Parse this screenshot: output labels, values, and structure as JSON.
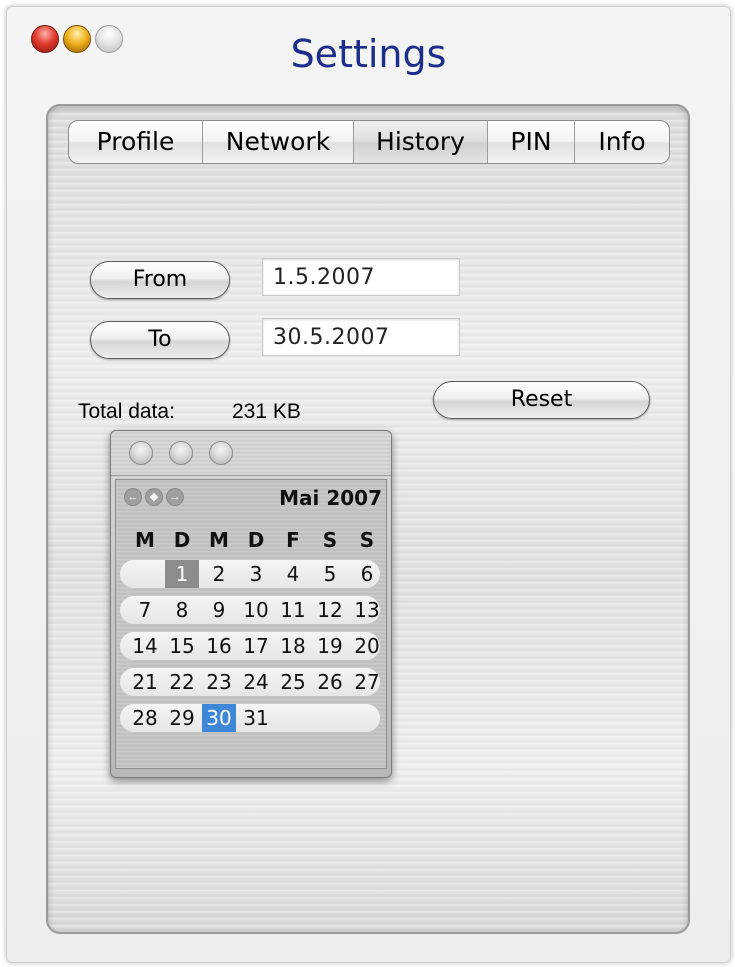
{
  "window": {
    "title": "Settings"
  },
  "tabs": [
    {
      "label": "Profile",
      "selected": false
    },
    {
      "label": "Network",
      "selected": false
    },
    {
      "label": "History",
      "selected": true
    },
    {
      "label": "PIN",
      "selected": false
    },
    {
      "label": "Info",
      "selected": false
    }
  ],
  "history": {
    "from_label": "From",
    "from_value": "1.5.2007",
    "to_label": "To",
    "to_value": "30.5.2007",
    "total_label": "Total data:",
    "total_value": "231 KB",
    "reset_label": "Reset"
  },
  "calendar": {
    "month": "Mai 2007",
    "weekdays": [
      "M",
      "D",
      "M",
      "D",
      "F",
      "S",
      "S"
    ],
    "weeks": [
      [
        "",
        "1",
        "2",
        "3",
        "4",
        "5",
        "6"
      ],
      [
        "7",
        "8",
        "9",
        "10",
        "11",
        "12",
        "13"
      ],
      [
        "14",
        "15",
        "16",
        "17",
        "18",
        "19",
        "20"
      ],
      [
        "21",
        "22",
        "23",
        "24",
        "25",
        "26",
        "27"
      ],
      [
        "28",
        "29",
        "30",
        "31",
        "",
        "",
        ""
      ]
    ],
    "range_start_day": "1",
    "selected_day": "30",
    "nav_icons": [
      "arrow-left-icon",
      "diamond-icon",
      "arrow-right-icon"
    ]
  },
  "colors": {
    "title": "#1c2d8a",
    "selected_day": "#3d86d8"
  }
}
